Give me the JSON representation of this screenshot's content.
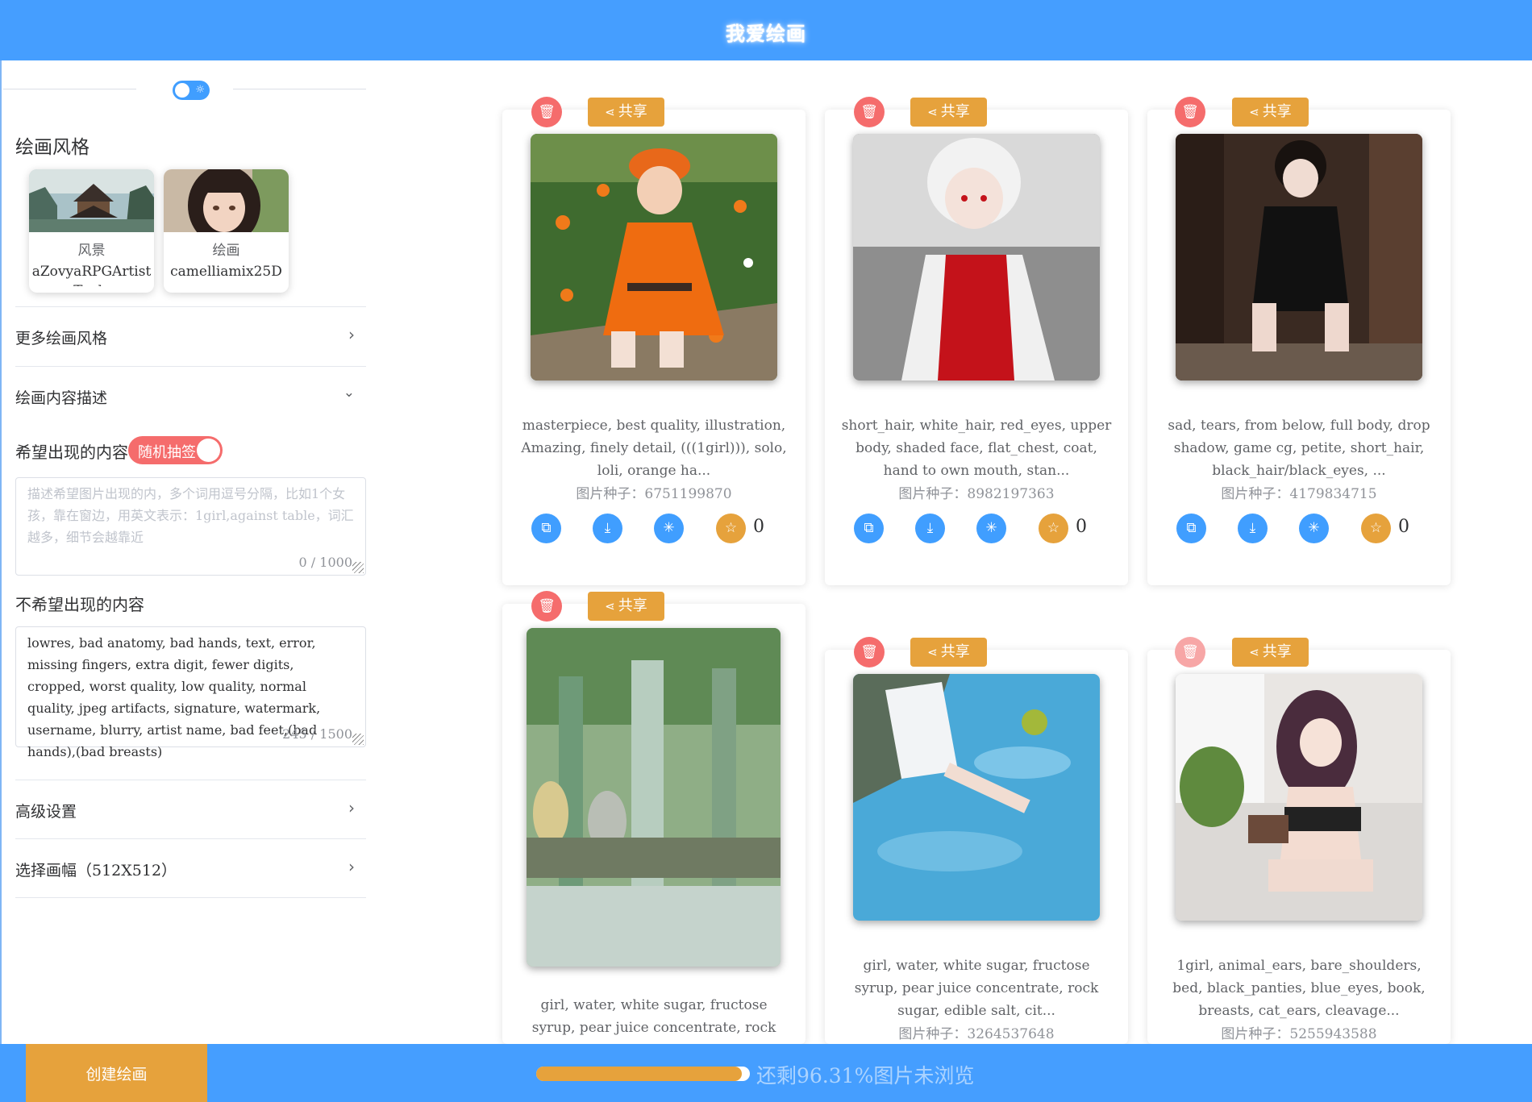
{
  "app": {
    "title": "我爱绘画"
  },
  "left_panel": {
    "style_section_title": "绘画风格",
    "styles": [
      {
        "category": "风景",
        "model": "aZovyaRPGArtistTools"
      },
      {
        "category": "绘画",
        "model": "camelliamix25D"
      }
    ],
    "more_styles_label": "更多绘画风格",
    "content_desc_label": "绘画内容描述",
    "wanted_label": "希望出现的内容",
    "random_tag_label": "随机抽签",
    "wanted_placeholder": "描述希望图片出现的内，多个词用逗号分隔，比如1个女孩，靠在窗边，用英文表示：1girl,against table，词汇越多，细节会越靠近",
    "wanted_count": "0 / 1000",
    "unwanted_label": "不希望出现的内容",
    "unwanted_value": "lowres, bad anatomy, bad hands, text, error, missing fingers, extra digit, fewer digits, cropped, worst quality, low quality, normal quality, jpeg artifacts, signature, watermark, username, blurry, artist name, bad feet,(bad hands),(bad breasts)",
    "unwanted_count": "245 / 1500",
    "advanced_label": "高级设置",
    "canvas_label": "选择画幅（512X512）"
  },
  "share_label": "共享",
  "cards": [
    {
      "desc": "masterpiece, best quality, illustration, Amazing, finely detail, (((1girl))), solo, loli, orange ha...",
      "seed": "图片种子：6751199870",
      "likes": "0"
    },
    {
      "desc": "short_hair, white_hair, red_eyes, upper body, shaded face, flat_chest, coat, hand to own mouth, stan...",
      "seed": "图片种子：8982197363",
      "likes": "0"
    },
    {
      "desc": "sad, tears, from below, full body, drop shadow, game cg, petite, short_hair, black_hair/black_eyes, ...",
      "seed": "图片种子：4179834715",
      "likes": "0"
    },
    {
      "desc": "girl, water, white sugar, fructose syrup, pear juice concentrate, rock",
      "seed": "",
      "likes": ""
    },
    {
      "desc": "girl, water, white sugar, fructose syrup, pear juice concentrate, rock sugar, edible salt, cit...",
      "seed": "图片种子：3264537648",
      "likes": ""
    },
    {
      "desc": "1girl, animal_ears, bare_shoulders, bed, black_panties, blue_eyes, book, breasts, cat_ears, cleavage...",
      "seed": "图片种子：5255943588",
      "likes": ""
    }
  ],
  "bottom": {
    "create_label": "创建绘画",
    "progress_fraction": 0.9631,
    "progress_text": "还剩96.31%图片未浏览"
  },
  "colors": {
    "primary": "#459eff",
    "accent": "#e6a23c",
    "danger": "#f56c6c"
  },
  "icons": [
    "trash-icon",
    "share-icon",
    "copy-icon",
    "download-icon",
    "sparkle-icon",
    "star-icon",
    "chevron-right-icon",
    "chevron-down-icon",
    "sun-icon"
  ]
}
